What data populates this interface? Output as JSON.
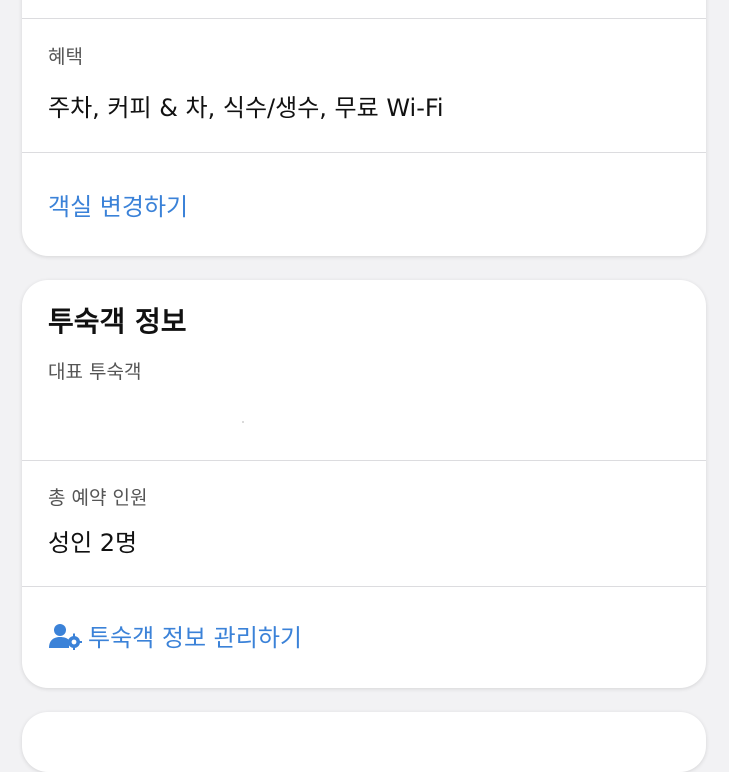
{
  "room_card": {
    "benefits_label": "혜택",
    "benefits_value": "주차, 커피 & 차, 식수/생수, 무료 Wi-Fi",
    "change_room_link": "객실 변경하기"
  },
  "guest_card": {
    "title": "투숙객 정보",
    "lead_guest_label": "대표 투숙객",
    "lead_guest_value": "",
    "total_guests_label": "총 예약 인원",
    "total_guests_value": "성인 2명",
    "manage_link": "투숙객 정보 관리하기",
    "manage_icon": "user-gear-icon"
  },
  "colors": {
    "accent": "#3b82d8",
    "background": "#f2f2f4",
    "card": "#ffffff",
    "divider": "#dcdcdf"
  }
}
